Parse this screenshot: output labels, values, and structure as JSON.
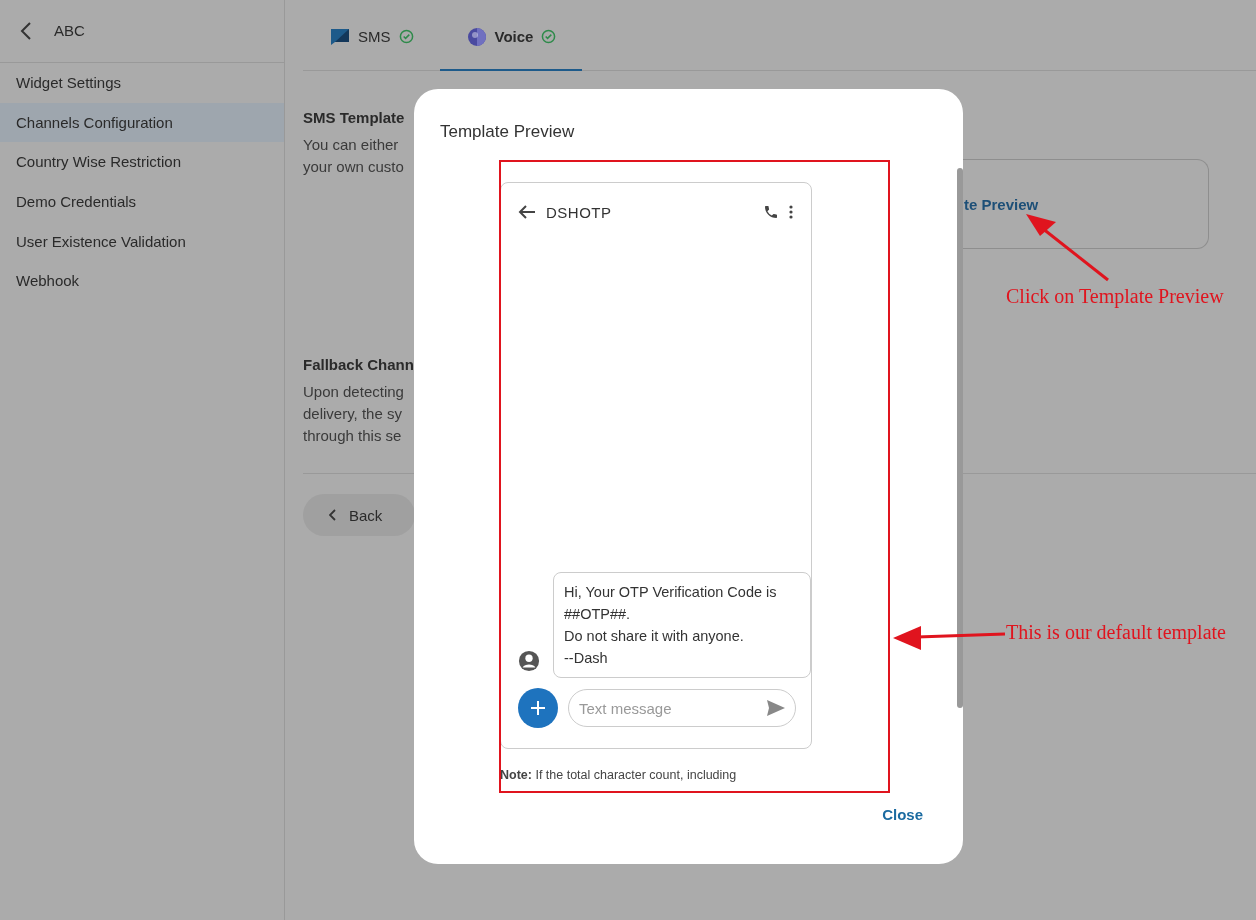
{
  "sidebar": {
    "title": "ABC",
    "items": [
      {
        "label": "Widget Settings",
        "selected": false
      },
      {
        "label": "Channels Configuration",
        "selected": true
      },
      {
        "label": "Country Wise Restriction",
        "selected": false
      },
      {
        "label": "Demo Credentials",
        "selected": false
      },
      {
        "label": "User Existence Validation",
        "selected": false
      },
      {
        "label": "Webhook",
        "selected": false
      }
    ]
  },
  "tabs": [
    {
      "label": "SMS",
      "kind": "sms",
      "selected": false
    },
    {
      "label": "Voice",
      "kind": "voice",
      "selected": true
    }
  ],
  "sms_template": {
    "title": "SMS Template",
    "description_lines": [
      "You can either",
      "your own custo"
    ],
    "preview_link": "te Preview"
  },
  "fallback": {
    "title": "Fallback Chann",
    "description_lines": [
      "Upon detecting",
      "delivery, the sy",
      "through this se"
    ]
  },
  "back_button": "Back",
  "modal": {
    "title": "Template Preview",
    "phone": {
      "sender": "DSHOTP",
      "message_lines": [
        "Hi, Your OTP Verification Code is",
        "##OTP##.",
        "Do not share it with anyone.",
        "--Dash"
      ],
      "input_placeholder": "Text message"
    },
    "note": "**Note:** If the total character count, including",
    "close_button": "Close"
  },
  "annotations": [
    {
      "text": "Click on Template Preview"
    },
    {
      "text": "This is our default template"
    }
  ]
}
